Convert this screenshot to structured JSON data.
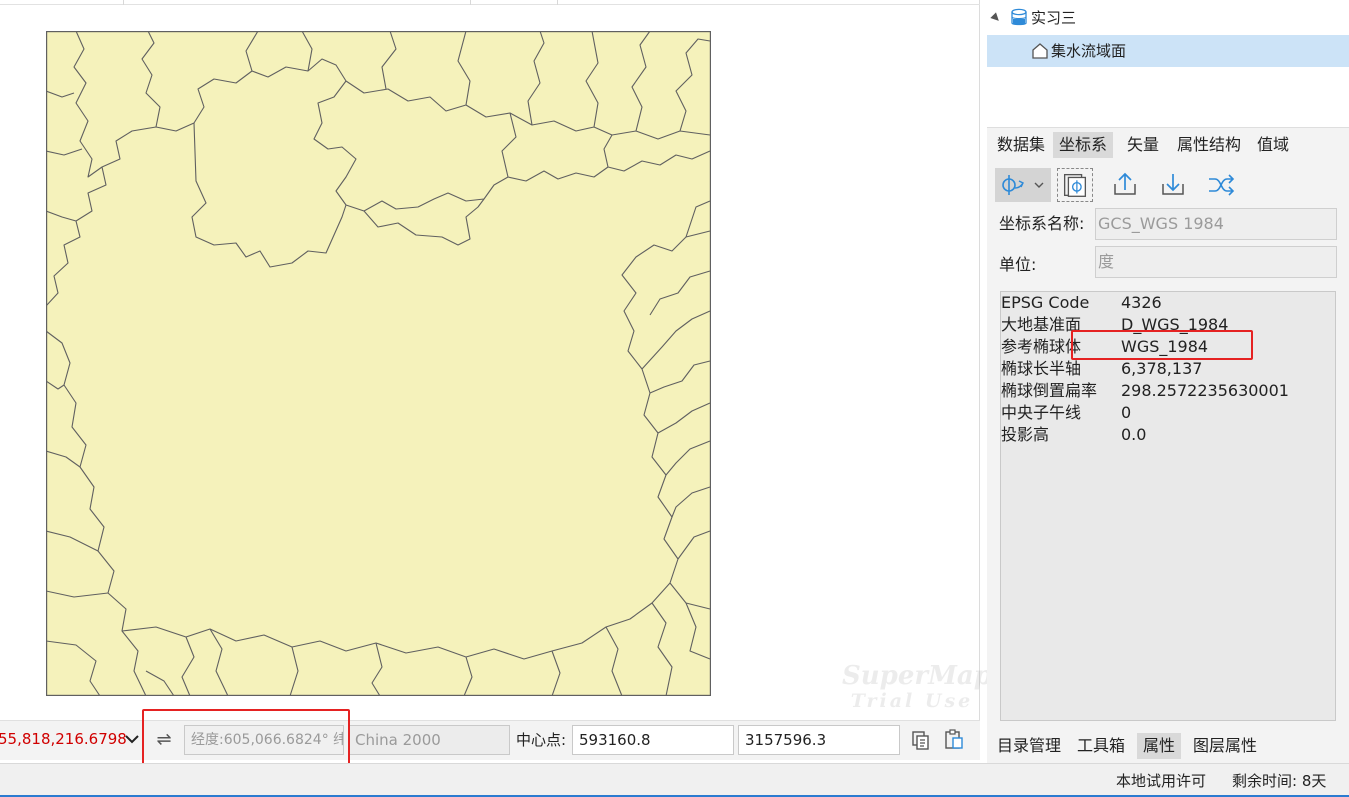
{
  "map": {
    "fill_color": "#f5f2bb",
    "stroke_color": "#606060",
    "watermark_line1": "SuperMap",
    "watermark_line2": "Trial Use"
  },
  "map_toolbar": {
    "scale_value": "55,818,216.6798",
    "coordinate_display": "经度:605,066.6824° 纬",
    "crs_display": "China 2000",
    "center_label": "中心点:",
    "center_x": "593160.8",
    "center_y": "3157596.3"
  },
  "tree": {
    "datasource": "实习三",
    "layer": "集水流域面"
  },
  "property_tabs": [
    "数据集",
    "坐标系",
    "矢量",
    "属性结构",
    "值域"
  ],
  "crs": {
    "name_label": "坐标系名称:",
    "name_value": "GCS_WGS 1984",
    "unit_label": "单位:",
    "unit_value": "度"
  },
  "crs_info": [
    {
      "key": "EPSG Code",
      "value": "4326"
    },
    {
      "key": "大地基准面",
      "value": "D_WGS_1984"
    },
    {
      "key": "参考椭球体",
      "value": "WGS_1984"
    },
    {
      "key": "椭球长半轴",
      "value": "6,378,137"
    },
    {
      "key": "椭球倒置扁率",
      "value": "298.2572235630001"
    },
    {
      "key": "中央子午线",
      "value": "0"
    },
    {
      "key": "投影高",
      "value": "0.0"
    }
  ],
  "bottom_tabs": [
    "目录管理",
    "工具箱",
    "属性",
    "图层属性"
  ],
  "status": {
    "license": "本地试用许可",
    "remaining": "剩余时间: 8天"
  },
  "colors": {
    "highlight_red": "#e52222",
    "tree_selection": "#cce3f7",
    "scale_text": "#d00000",
    "icon_blue": "#2e8ad8"
  }
}
